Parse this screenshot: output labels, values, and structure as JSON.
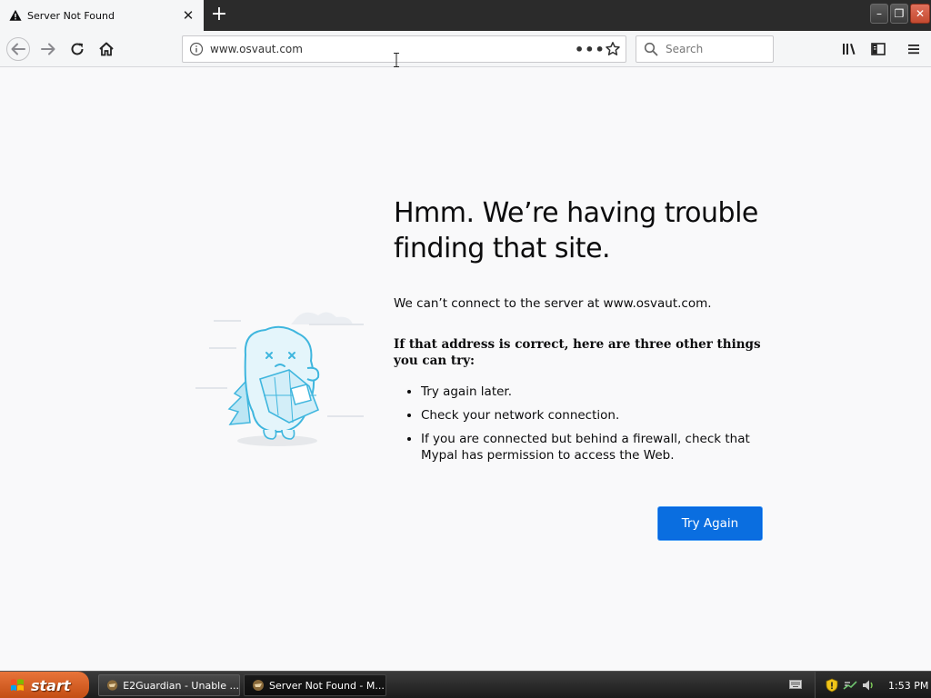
{
  "tab": {
    "title": "Server Not Found",
    "close_glyph": "✕",
    "icon": "warning-icon"
  },
  "newtab": {
    "glyph": "+"
  },
  "window_controls": {
    "minimize": "–",
    "restore": "❐",
    "close": "✕"
  },
  "navbar": {
    "url": "www.osvaut.com",
    "page_actions_glyph": "•••",
    "search_placeholder": "Search"
  },
  "page": {
    "heading": "Hmm. We’re having trouble finding that site.",
    "description": "We can’t connect to the server at www.osvaut.com.",
    "hint": "If that address is correct, here are three other things you can try:",
    "suggestions": [
      "Try again later.",
      "Check your network connection.",
      "If you are connected but behind a firewall, check that Mypal has permission to access the Web."
    ],
    "try_again_label": "Try Again"
  },
  "taskbar": {
    "start_label": "start",
    "tasks": [
      {
        "label": "E2Guardian - Unable ..."
      },
      {
        "label": "Server Not Found - M..."
      }
    ],
    "clock": "1:53 PM"
  },
  "colors": {
    "accent": "#0a6ee0",
    "start": "#d35c20",
    "illustration": "#3fb6de"
  }
}
